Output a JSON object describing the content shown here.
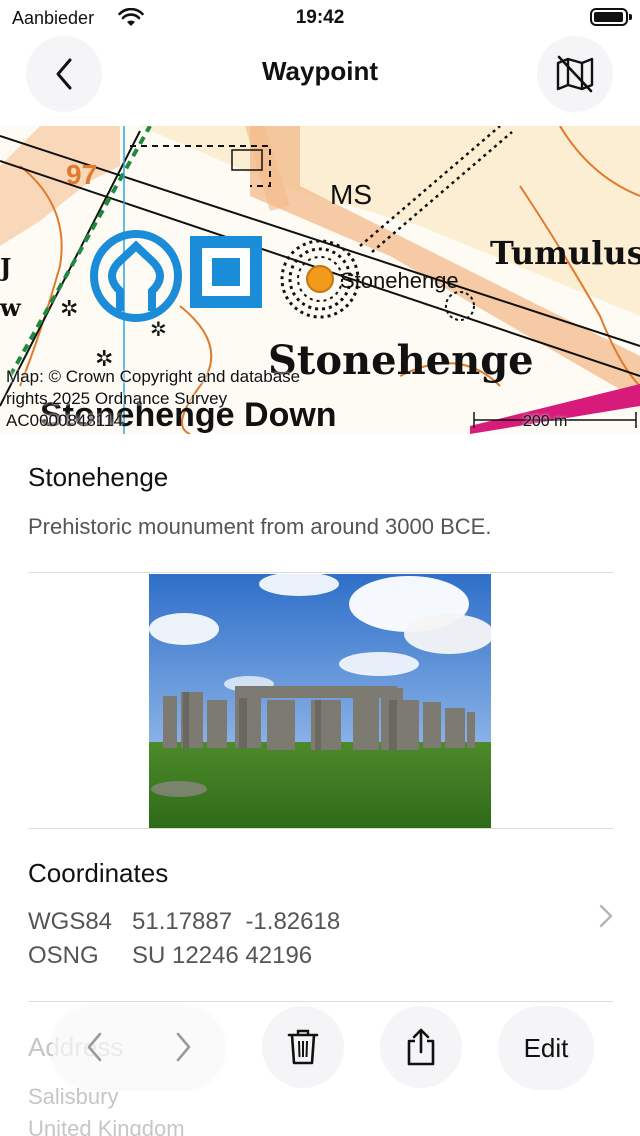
{
  "status_bar": {
    "carrier": "Aanbieder",
    "time": "19:42"
  },
  "nav": {
    "title": "Waypoint",
    "back_icon": "chevron-left-icon",
    "map_icon": "map-slash-icon"
  },
  "map": {
    "attribution": "Map: © Crown Copyright and database rights 2025 Ordnance Survey AC0000848114",
    "scale_label": "200 m",
    "labels": {
      "road_number": "97",
      "ms": "MS",
      "tumulus": "Tumulus",
      "marker_label": "Stonehenge",
      "site_name": "Stonehenge",
      "down": "Stonehenge Down"
    },
    "colors": {
      "road": "#f3b98a",
      "contour": "#e07a2e",
      "grid": "#29a7dc",
      "parcel": "#d81b7a",
      "hedge": "#1b8a3a",
      "unesco": "#1a8cd8",
      "marker": "#f29a1b"
    }
  },
  "waypoint": {
    "name": "Stonehenge",
    "description": "Prehistoric mounument from around 3000 BCE."
  },
  "coordinates": {
    "title": "Coordinates",
    "rows": [
      {
        "system": "WGS84",
        "value": "51.17887  -1.82618"
      },
      {
        "system": "OSNG",
        "value": "SU 12246 42196"
      }
    ]
  },
  "address": {
    "title": "Address",
    "lines": [
      "Salisbury",
      "United Kingdom"
    ]
  },
  "toolbar": {
    "edit_label": "Edit",
    "prev_icon": "chevron-left-icon",
    "next_icon": "chevron-right-icon",
    "delete_icon": "trash-icon",
    "share_icon": "share-icon"
  }
}
